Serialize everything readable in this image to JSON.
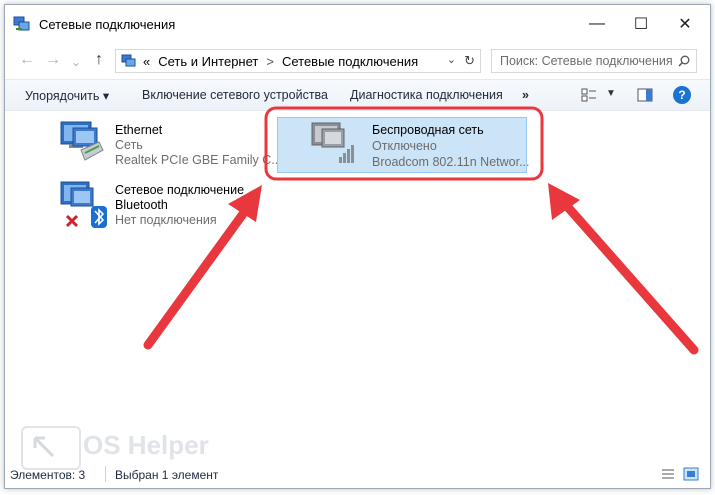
{
  "window": {
    "title": "Сетевые подключения",
    "controls": {
      "minimize": "—",
      "maximize": "☐",
      "close": "✕"
    }
  },
  "nav": {
    "back": "←",
    "forward": "→",
    "history": "⌄",
    "up": "↑",
    "breadcrumb_prefix": "«",
    "breadcrumb": [
      "Сеть и Интернет",
      "Сетевые подключения"
    ],
    "separator": ">",
    "refresh": "↻",
    "search_placeholder": "Поиск: Сетевые подключения"
  },
  "toolbar": {
    "organize": "Упорядочить",
    "enable_device": "Включение сетевого устройства",
    "diagnostics": "Диагностика подключения",
    "more": "»",
    "help": "?"
  },
  "connections": [
    {
      "name": "Ethernet",
      "status": "Сеть",
      "adapter": "Realtek PCIe GBE Family C..."
    },
    {
      "name": "Беспроводная сеть",
      "status": "Отключено",
      "adapter": "Broadcom 802.11n Networ..."
    },
    {
      "name": "Сетевое подключение",
      "name2": "Bluetooth",
      "status": "Нет подключения"
    }
  ],
  "statusbar": {
    "items_count": "Элементов: 3",
    "selected": "Выбран 1 элемент"
  },
  "watermark": "OS Helper",
  "colors": {
    "annotation_red": "#e8383d",
    "selection": "#cce4f7"
  }
}
